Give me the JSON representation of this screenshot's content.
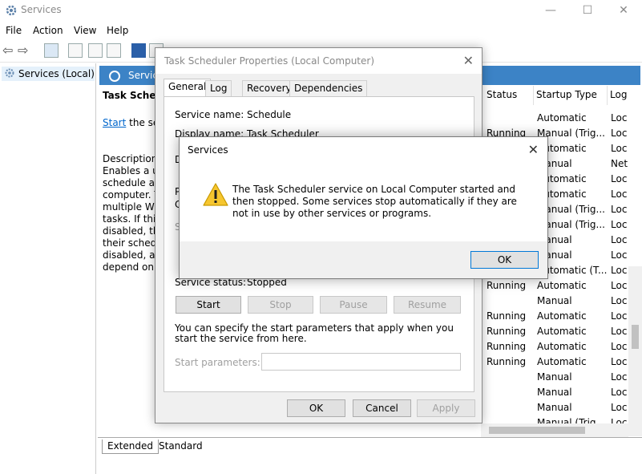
{
  "window": {
    "title": "Services",
    "minimize": "—",
    "maximize": "☐",
    "close": "✕"
  },
  "menu": [
    "File",
    "Action",
    "View",
    "Help"
  ],
  "tree": {
    "root_label": "Services (Local)"
  },
  "content": {
    "header": "Service",
    "selected_title": "Task Schedule",
    "start_link": "Start",
    "start_suffix": " the serv",
    "description_label": "Description:",
    "description_lines": [
      "Enables a use",
      "schedule aut",
      "computer. Th",
      "multiple Win",
      "tasks. If this s",
      "disabled, the",
      "their schedul",
      "disabled, any",
      "depend on it"
    ],
    "columns": {
      "status": "Status",
      "startup": "Startup Type",
      "log": "Log"
    },
    "rows": [
      {
        "status": "",
        "startup": "Automatic",
        "log": "Loc"
      },
      {
        "status": "Running",
        "startup": "Manual (Trig...",
        "log": "Loc"
      },
      {
        "status": "",
        "startup": "Automatic",
        "log": "Loc"
      },
      {
        "status": "",
        "startup": "Manual",
        "log": "Net"
      },
      {
        "status": "",
        "startup": "Automatic",
        "log": "Loc"
      },
      {
        "status": "",
        "startup": "Automatic",
        "log": "Loc"
      },
      {
        "status": "",
        "startup": "Manual (Trig...",
        "log": "Loc"
      },
      {
        "status": "",
        "startup": "Manual (Trig...",
        "log": "Loc"
      },
      {
        "status": "",
        "startup": "Manual",
        "log": "Loc"
      },
      {
        "status": "",
        "startup": "Manual",
        "log": "Loc"
      },
      {
        "status": "",
        "startup": "Automatic (T...",
        "log": "Loc"
      },
      {
        "status": "Running",
        "startup": "Automatic",
        "log": "Loc"
      },
      {
        "status": "",
        "startup": "Manual",
        "log": "Loc"
      },
      {
        "status": "Running",
        "startup": "Automatic",
        "log": "Loc"
      },
      {
        "status": "Running",
        "startup": "Automatic",
        "log": "Loc"
      },
      {
        "status": "Running",
        "startup": "Automatic",
        "log": "Loc"
      },
      {
        "status": "Running",
        "startup": "Automatic",
        "log": "Loc"
      },
      {
        "status": "",
        "startup": "Manual",
        "log": "Loc"
      },
      {
        "status": "",
        "startup": "Manual",
        "log": "Loc"
      },
      {
        "status": "",
        "startup": "Manual",
        "log": "Loc"
      },
      {
        "status": "",
        "startup": "Manual (Trig...",
        "log": "Loc"
      }
    ],
    "tabs": {
      "extended": "Extended",
      "standard": "Standard"
    }
  },
  "properties": {
    "title": "Task Scheduler Properties (Local Computer)",
    "close": "✕",
    "tabs": [
      "General",
      "Log On",
      "Recovery",
      "Dependencies"
    ],
    "service_name_label": "Service name:",
    "service_name_value": "Schedule",
    "display_name_label": "Display name:",
    "display_name_value": "Task Scheduler",
    "hidden_label_d": "D",
    "hidden_label_p": "P",
    "hidden_label_c": "C",
    "hidden_label_s": "S",
    "status_label": "Service status:",
    "status_value": "Stopped",
    "buttons": {
      "start": "Start",
      "stop": "Stop",
      "pause": "Pause",
      "resume": "Resume"
    },
    "params_note": "You can specify the start parameters that apply when you start the service from here.",
    "params_label": "Start parameters:",
    "params_value": "",
    "footer": {
      "ok": "OK",
      "cancel": "Cancel",
      "apply": "Apply"
    }
  },
  "message": {
    "title": "Services",
    "close": "✕",
    "text": "The Task Scheduler service on Local Computer started and then stopped. Some services stop automatically if they are not in use by other services or programs.",
    "ok": "OK",
    "icon": "warning-icon"
  }
}
